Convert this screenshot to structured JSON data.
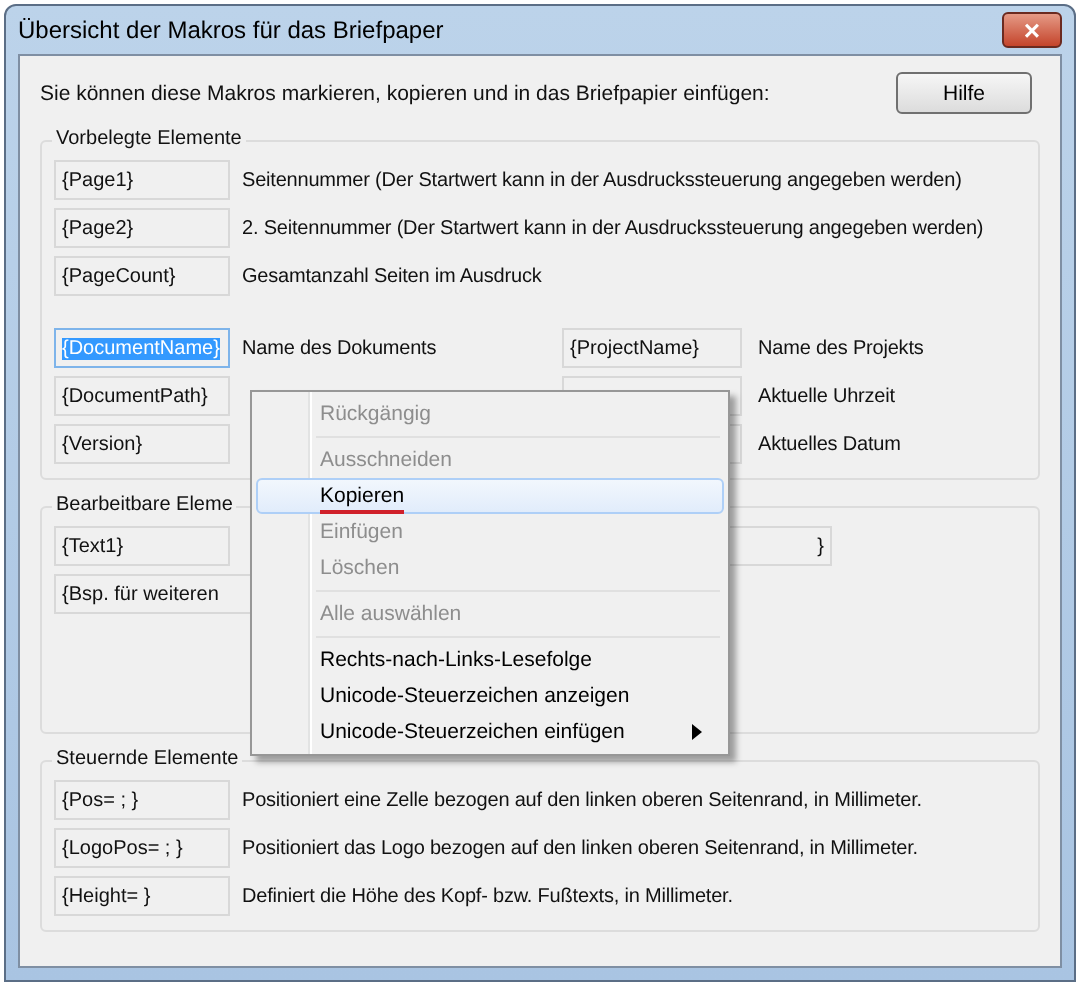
{
  "window": {
    "title": "Übersicht der Makros für das Briefpaper",
    "close": "×"
  },
  "intro": "Sie können diese Makros markieren, kopieren und in das Briefpapier einfügen:",
  "help_button": "Hilfe",
  "groups": [
    {
      "title": "Vorbelegte Elemente",
      "rows": [
        {
          "macro": {
            "text": "{Page1}",
            "selected": false
          },
          "description": "Seitennummer (Der Startwert kann in der Ausdruckssteuerung angegeben werden)"
        },
        {
          "macro": {
            "text": "{Page2}",
            "selected": false
          },
          "description": "2. Seitennummer (Der Startwert kann in der Ausdruckssteuerung angegeben werden)"
        },
        {
          "macro": {
            "text": "{PageCount}",
            "selected": false
          },
          "description": "Gesamtanzahl Seiten im Ausdruck"
        },
        {
          "macro": {
            "text": "{DocumentName}",
            "selected": true
          },
          "description": "Name des Dokuments",
          "macro_2": {
            "text": "{ProjectName}",
            "selected": false
          },
          "description_2": "Name des Projekts"
        },
        {
          "macro": {
            "text": "{DocumentPath}",
            "selected": false
          },
          "macro_2": {
            "selected": false
          },
          "description_2": "Aktuelle Uhrzeit"
        },
        {
          "macro": {
            "text": "{Version}",
            "selected": false
          },
          "macro_2": {
            "selected": false
          },
          "description_2": "Aktuelles Datum"
        }
      ]
    },
    {
      "title": "Bearbeitbare Eleme",
      "rows": [
        {
          "macro": {
            "text": "{Text1}",
            "selected": false
          },
          "macro_2": {
            "text": "}",
            "selected": false
          }
        },
        {
          "macro": {
            "text": "{Bsp. für weiteren",
            "selected": false
          }
        }
      ]
    },
    {
      "title": "Steuernde Elemente",
      "rows": [
        {
          "macro": {
            "text": "{Pos=  ;  }",
            "selected": false
          },
          "description": "Positioniert eine Zelle bezogen auf den linken oberen Seitenrand, in Millimeter."
        },
        {
          "macro": {
            "text": "{LogoPos=  ;  }",
            "selected": false
          },
          "description": "Positioniert das Logo bezogen auf den linken oberen Seitenrand, in Millimeter."
        },
        {
          "macro": {
            "text": "{Height=  }",
            "selected": false
          },
          "description": "Definiert die Höhe des Kopf- bzw. Fußtexts, in Millimeter."
        }
      ]
    }
  ],
  "context_menu": [
    {
      "kind": "item",
      "label": "Rückgängig",
      "disabled": true,
      "selected": false
    },
    {
      "kind": "separator"
    },
    {
      "kind": "item",
      "label": "Ausschneiden",
      "disabled": true,
      "selected": false
    },
    {
      "kind": "item",
      "label": "Kopieren",
      "disabled": false,
      "selected": true,
      "underlined": true
    },
    {
      "kind": "item",
      "label": "Einfügen",
      "disabled": true,
      "selected": false
    },
    {
      "kind": "item",
      "label": "Löschen",
      "disabled": true,
      "selected": false
    },
    {
      "kind": "separator"
    },
    {
      "kind": "item",
      "label": "Alle auswählen",
      "disabled": true,
      "selected": false
    },
    {
      "kind": "separator"
    },
    {
      "kind": "item",
      "label": "Rechts-nach-Links-Lesefolge",
      "disabled": false,
      "selected": false
    },
    {
      "kind": "item",
      "label": "Unicode-Steuerzeichen anzeigen",
      "disabled": false,
      "selected": false
    },
    {
      "kind": "submenu",
      "label": "Unicode-Steuerzeichen einfügen",
      "disabled": false,
      "selected": false
    }
  ]
}
